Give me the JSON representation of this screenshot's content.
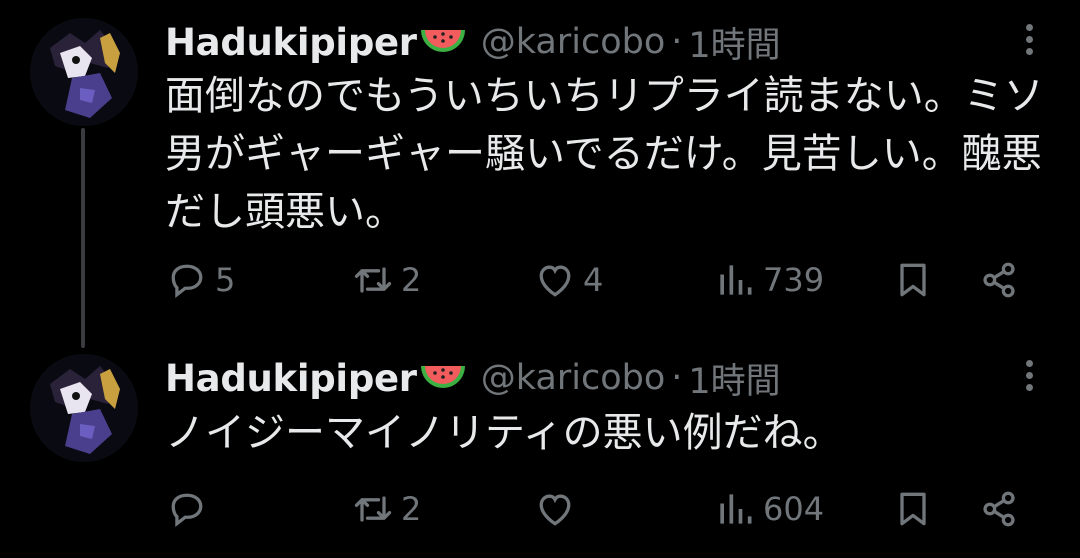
{
  "tweets": [
    {
      "author": {
        "name": "Hadukipiper",
        "emoji_icon": "watermelon-icon",
        "handle": "@karicobo"
      },
      "time": "1時間",
      "separator": "·",
      "text": "面倒なのでもういちいちリプライ読まない。ミソ男がギャーギャー騒いでるだけ。見苦しい。醜悪だし頭悪い。",
      "actions": {
        "replies": "5",
        "retweets": "2",
        "likes": "4",
        "views": "739"
      }
    },
    {
      "author": {
        "name": "Hadukipiper",
        "emoji_icon": "watermelon-icon",
        "handle": "@karicobo"
      },
      "time": "1時間",
      "separator": "·",
      "text": "ノイジーマイノリティの悪い例だね。",
      "actions": {
        "replies": "",
        "retweets": "2",
        "likes": "",
        "views": "604"
      }
    }
  ],
  "colors": {
    "background": "#000000",
    "text": "#e7e9ea",
    "muted": "#71767b",
    "thread_line": "#3a3c40"
  }
}
